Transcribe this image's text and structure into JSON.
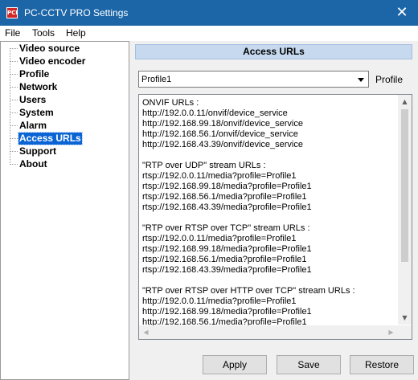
{
  "window": {
    "app_icon_text": "PCI",
    "title": "PC-CCTV PRO Settings",
    "close_glyph": "✕"
  },
  "menu": {
    "items": [
      "File",
      "Tools",
      "Help"
    ]
  },
  "sidebar": {
    "items": [
      {
        "label": "Video source",
        "selected": false
      },
      {
        "label": "Video encoder",
        "selected": false
      },
      {
        "label": "Profile",
        "selected": false
      },
      {
        "label": "Network",
        "selected": false
      },
      {
        "label": "Users",
        "selected": false
      },
      {
        "label": "System",
        "selected": false
      },
      {
        "label": "Alarm",
        "selected": false
      },
      {
        "label": "Access URLs",
        "selected": true
      },
      {
        "label": "Support",
        "selected": false
      },
      {
        "label": "About",
        "selected": false
      }
    ]
  },
  "main": {
    "section_title": "Access URLs",
    "profile_select": {
      "value": "Profile1",
      "label": "Profile"
    },
    "urls_text": "ONVIF URLs :\nhttp://192.0.0.11/onvif/device_service\nhttp://192.168.99.18/onvif/device_service\nhttp://192.168.56.1/onvif/device_service\nhttp://192.168.43.39/onvif/device_service\n\n\"RTP over UDP\" stream URLs :\nrtsp://192.0.0.11/media?profile=Profile1\nrtsp://192.168.99.18/media?profile=Profile1\nrtsp://192.168.56.1/media?profile=Profile1\nrtsp://192.168.43.39/media?profile=Profile1\n\n\"RTP over RTSP over TCP\" stream URLs :\nrtsp://192.0.0.11/media?profile=Profile1\nrtsp://192.168.99.18/media?profile=Profile1\nrtsp://192.168.56.1/media?profile=Profile1\nrtsp://192.168.43.39/media?profile=Profile1\n\n\"RTP over RTSP over HTTP over TCP\" stream URLs :\nhttp://192.0.0.11/media?profile=Profile1\nhttp://192.168.99.18/media?profile=Profile1\nhttp://192.168.56.1/media?profile=Profile1"
  },
  "scrollbar_glyphs": {
    "up": "▲",
    "down": "▼",
    "left": "◀",
    "right": "▶"
  },
  "buttons": {
    "apply": "Apply",
    "save": "Save",
    "restore": "Restore"
  },
  "colors": {
    "titlebar": "#1c66a8",
    "selection": "#0a64d4",
    "section_header": "#c6d9ef"
  }
}
